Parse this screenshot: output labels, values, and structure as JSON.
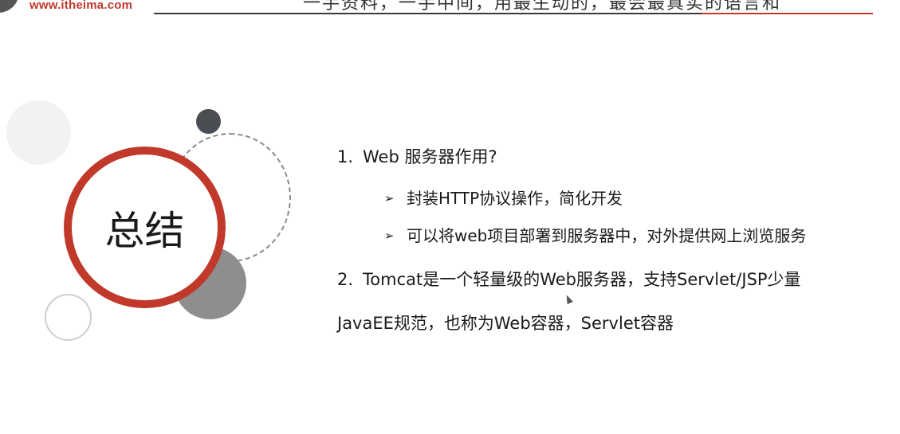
{
  "header": {
    "logo_url": "www.itheima.com",
    "slogan": "一手资料，一手中间，用最生动的，最会最真实的语言和"
  },
  "summary": {
    "title": "总结"
  },
  "content": {
    "items": [
      {
        "number": "1.",
        "text": "Web 服务器作用?",
        "bullets": [
          {
            "marker": "➢",
            "text": "封装HTTP协议操作，简化开发"
          },
          {
            "marker": "➢",
            "text": "可以将web项目部署到服务器中，对外提供网上浏览服务"
          }
        ]
      },
      {
        "number": "2.",
        "text": "Tomcat是一个轻量级的Web服务器，支持Servlet/JSP少量",
        "continuation": "JavaEE规范，也称为Web容器，Servlet容器"
      }
    ]
  },
  "icons": {
    "logo": "itheima-logo-icon",
    "bullet": "arrow-bullet-icon",
    "cursor": "mouse-cursor-icon"
  },
  "colors": {
    "accent_red": "#c0392b",
    "dark_gray": "#4a4e52",
    "mid_gray": "#8e8e8e",
    "light_gray": "#f2f2f2",
    "text": "#1a1a1a"
  }
}
